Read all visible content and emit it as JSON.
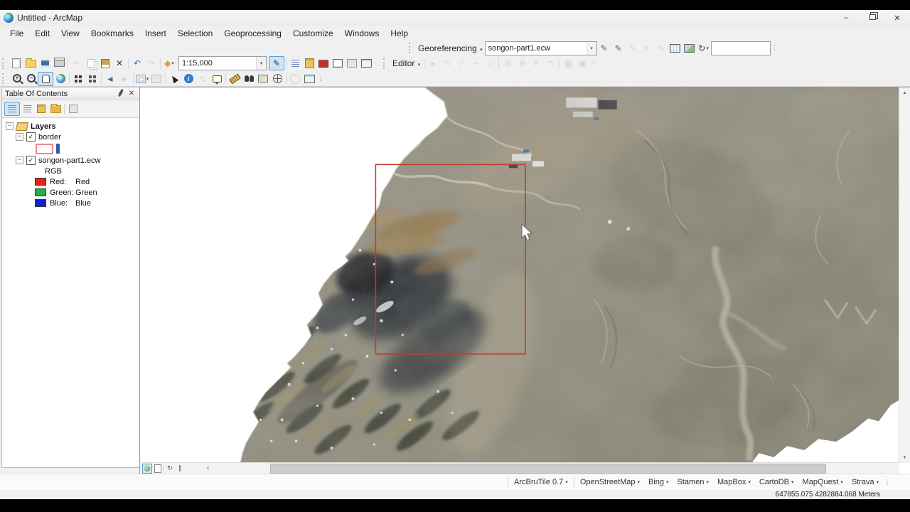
{
  "titlebar": {
    "title": "Untitled - ArcMap"
  },
  "menubar": {
    "items": [
      "File",
      "Edit",
      "View",
      "Bookmarks",
      "Insert",
      "Selection",
      "Geoprocessing",
      "Customize",
      "Windows",
      "Help"
    ]
  },
  "toolbars": {
    "georeferencing": {
      "label": "Georeferencing",
      "layer_combo_value": "songon-part1.ecw"
    },
    "standard": {
      "scale_value": "1:15,000"
    },
    "editor": {
      "label": "Editor"
    }
  },
  "icons": {
    "minimize": "–",
    "close": "✕",
    "dropdown": "▾",
    "check": "✓",
    "collapse": "−",
    "cut": "✂",
    "delete": "✕",
    "undo": "↶",
    "redo": "↷",
    "add_data": "◆",
    "pencil": "✎",
    "pen": "✎",
    "back": "◄",
    "forward": "►",
    "up": "▲",
    "down": "▼",
    "scroll_left": "‹",
    "refresh": "↻",
    "pause": "∥",
    "overflow": "⋮",
    "rotate": "↻",
    "hyperlink": "↯",
    "info": "i",
    "editor_tools": [
      "▸",
      "✎",
      "∕",
      "⌐",
      "▱",
      "⊞",
      "⊕",
      "✕",
      "↰",
      "▦",
      "▣"
    ]
  },
  "toc": {
    "title": "Table Of Contents",
    "tree": {
      "root_label": "Layers",
      "border_layer": "border",
      "raster_layer": "songon-part1.ecw",
      "renderer": "RGB",
      "channels": [
        {
          "label": "Red:",
          "value": "Red",
          "color": "#e2231a"
        },
        {
          "label": "Green:",
          "value": "Green",
          "color": "#21b14c"
        },
        {
          "label": "Blue:",
          "value": "Blue",
          "color": "#0a24d6"
        }
      ]
    }
  },
  "map": {
    "border_rectangle_color": "#c23b2e"
  },
  "basemap_toolbar": {
    "items": [
      "ArcBruTile 0.7",
      "OpenStreetMap",
      "Bing",
      "Stamen",
      "MapBox",
      "CartoDB",
      "MapQuest",
      "Strava"
    ]
  },
  "statusbar": {
    "coordinates": "647855.075  4282884.068 Meters"
  }
}
